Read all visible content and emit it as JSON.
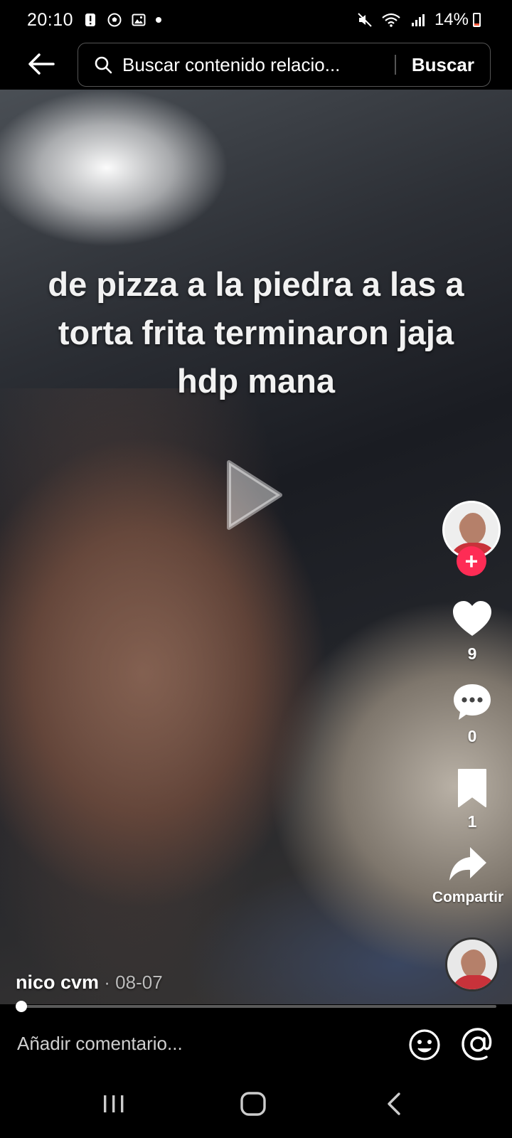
{
  "status_bar": {
    "time": "20:10",
    "battery_percent": "14%",
    "battery_level": 0.14,
    "left_icons": [
      "alert-icon",
      "soccer-icon",
      "image-icon",
      "dot-icon"
    ],
    "right_icons": [
      "mute-icon",
      "wifi-icon",
      "signal-icon",
      "battery-icon"
    ]
  },
  "search": {
    "query": "Buscar contenido relacio...",
    "button_label": "Buscar"
  },
  "video": {
    "caption_lines": [
      "de pizza a la piedra a las a",
      "torta frita terminaron jaja",
      "hdp mana"
    ]
  },
  "sidebar": {
    "likes": "9",
    "comments": "0",
    "saves": "1",
    "share_label": "Compartir"
  },
  "author": {
    "name": "nico cvm",
    "separator": " · ",
    "date": "08-07"
  },
  "player": {
    "progress_fraction": 0.0
  },
  "comment": {
    "placeholder": "Añadir comentario..."
  },
  "colors": {
    "accent": "#fe2c55",
    "battery_low": "#ff5a3c"
  }
}
